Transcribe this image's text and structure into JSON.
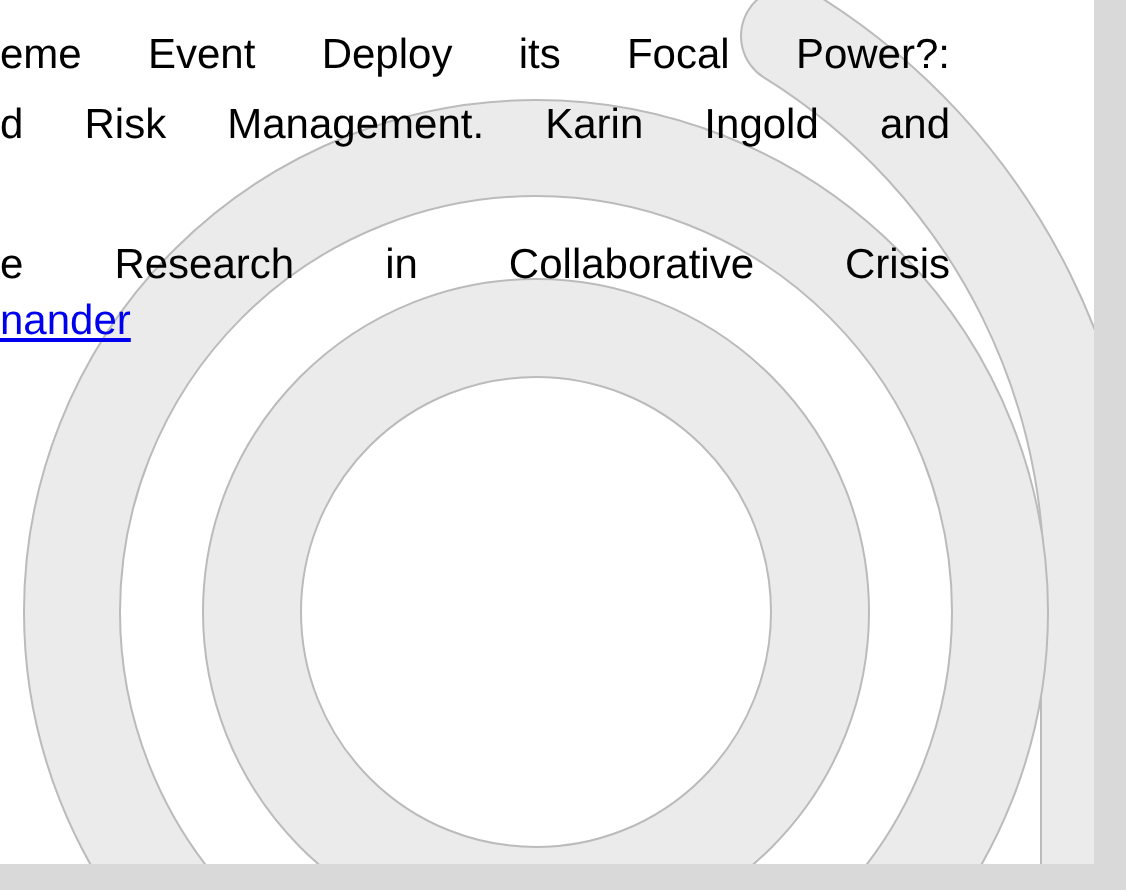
{
  "references": [
    {
      "lines": [
        "eme Event Deploy its Focal Power?:",
        "d Risk Management. Karin Ingold and"
      ]
    },
    {
      "lines": [
        "e Research in Collaborative Crisis"
      ],
      "link": "nander"
    }
  ]
}
